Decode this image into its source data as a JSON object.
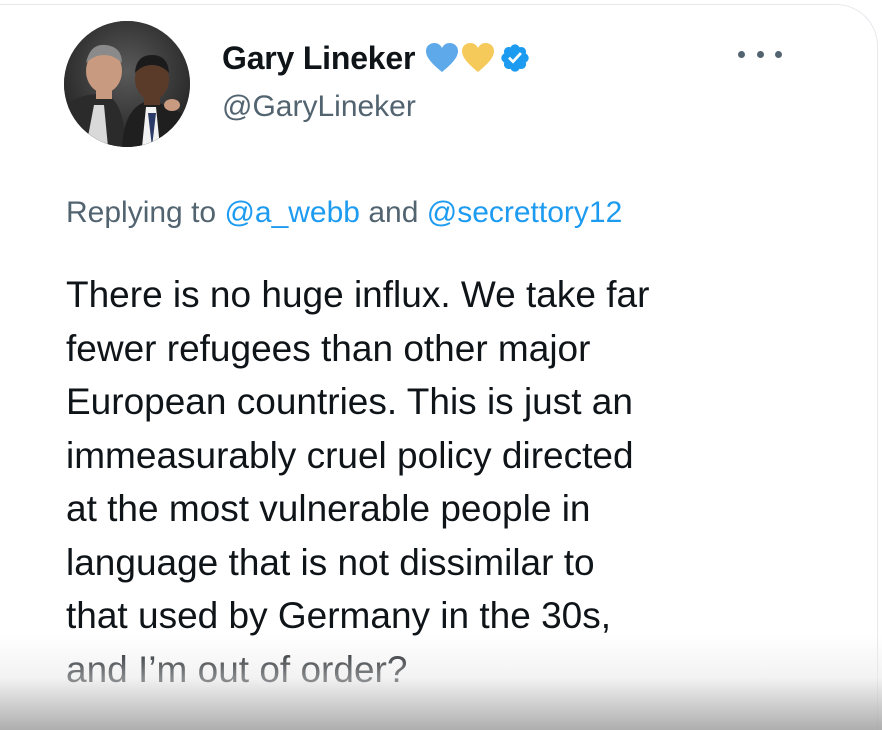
{
  "tweet": {
    "author": {
      "display_name": "Gary Lineker",
      "handle": "@GaryLineker",
      "avatar_icon": "profile-photo",
      "badges": [
        {
          "icon": "blue-heart-emoji",
          "color": "#5da9e9"
        },
        {
          "icon": "yellow-heart-emoji",
          "color": "#f5ca5a"
        },
        {
          "icon": "verified-badge-icon",
          "color": "#1d9bf0"
        }
      ]
    },
    "more_menu_icon": "more-options-icon",
    "reply_context": {
      "prefix": "Replying to",
      "mention_1": "@a_webb",
      "conjunction": "and",
      "mention_2": "@secrettory12"
    },
    "text_lines": [
      "There is no huge influx. We take far",
      "fewer refugees than other major",
      "European countries. This is just an",
      "immeasurably cruel policy directed",
      "at the most vulnerable people in",
      "language that is not dissimilar to",
      "that used by Germany in the 30s,",
      "and I’m out of order?"
    ]
  },
  "colors": {
    "text_primary": "#0f1419",
    "text_secondary": "#536471",
    "accent": "#1d9bf0"
  }
}
